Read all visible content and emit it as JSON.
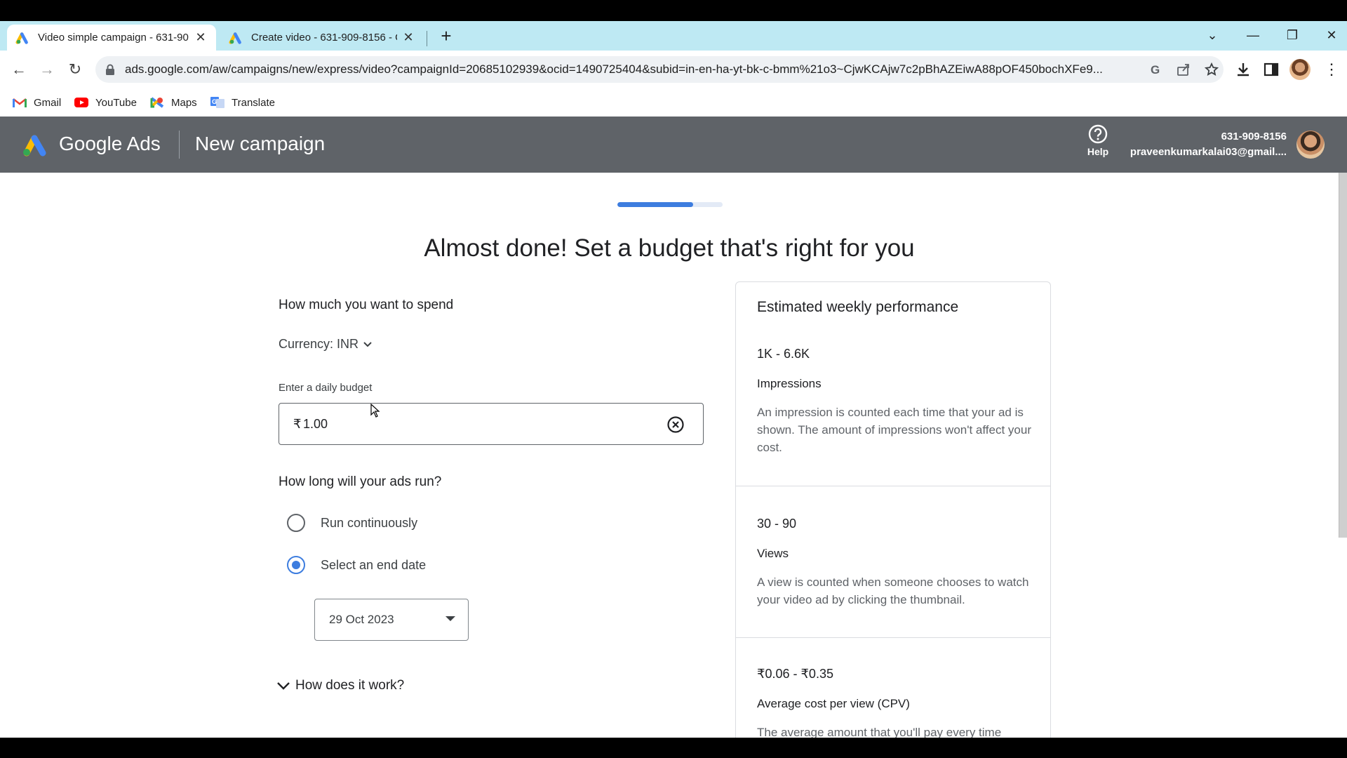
{
  "browser": {
    "tabs": [
      {
        "title": "Video simple campaign - 631-90",
        "active": true
      },
      {
        "title": "Create video - 631-909-8156 - G",
        "active": false
      }
    ],
    "url": "ads.google.com/aw/campaigns/new/express/video?campaignId=20685102939&ocid=1490725404&subid=in-en-ha-yt-bk-c-bmm%21o3~CjwKCAjw7c2pBhAZEiwA88pOF450bochXFe9...",
    "bookmarks": [
      {
        "label": "Gmail",
        "icon": "gmail-icon"
      },
      {
        "label": "YouTube",
        "icon": "youtube-icon"
      },
      {
        "label": "Maps",
        "icon": "maps-icon"
      },
      {
        "label": "Translate",
        "icon": "translate-icon"
      }
    ]
  },
  "ads_header": {
    "brand": "Google Ads",
    "page_title": "New campaign",
    "help_label": "Help",
    "account_id": "631-909-8156",
    "account_email": "praveenkumarkalai03@gmail...."
  },
  "progress": {
    "fraction": 0.72
  },
  "main": {
    "heading": "Almost done! Set a budget that's right for you",
    "spend_title": "How much you want to spend",
    "currency_label": "Currency: INR",
    "budget_label": "Enter a daily budget",
    "budget_symbol": "₹",
    "budget_value": "1.00",
    "duration_title": "How long will your ads run?",
    "radio_continuous": "Run continuously",
    "radio_end_date": "Select an end date",
    "end_date": "29 Oct 2023",
    "how_it_works": "How does it work?"
  },
  "performance": {
    "title": "Estimated weekly performance",
    "metrics": [
      {
        "value": "1K - 6.6K",
        "name": "Impressions",
        "desc": "An impression is counted each time that your ad is shown. The amount of impressions won't affect your cost."
      },
      {
        "value": "30 - 90",
        "name": "Views",
        "desc": "A view is counted when someone chooses to watch your video ad by clicking the thumbnail."
      },
      {
        "value": "₹0.06 - ₹0.35",
        "name": "Average cost per view (CPV)",
        "desc": "The average amount that you'll pay every time"
      }
    ]
  },
  "colors": {
    "accent": "#3d7ddf",
    "header_bg": "#5f6368",
    "tabbar_bg": "#bee9f3"
  }
}
